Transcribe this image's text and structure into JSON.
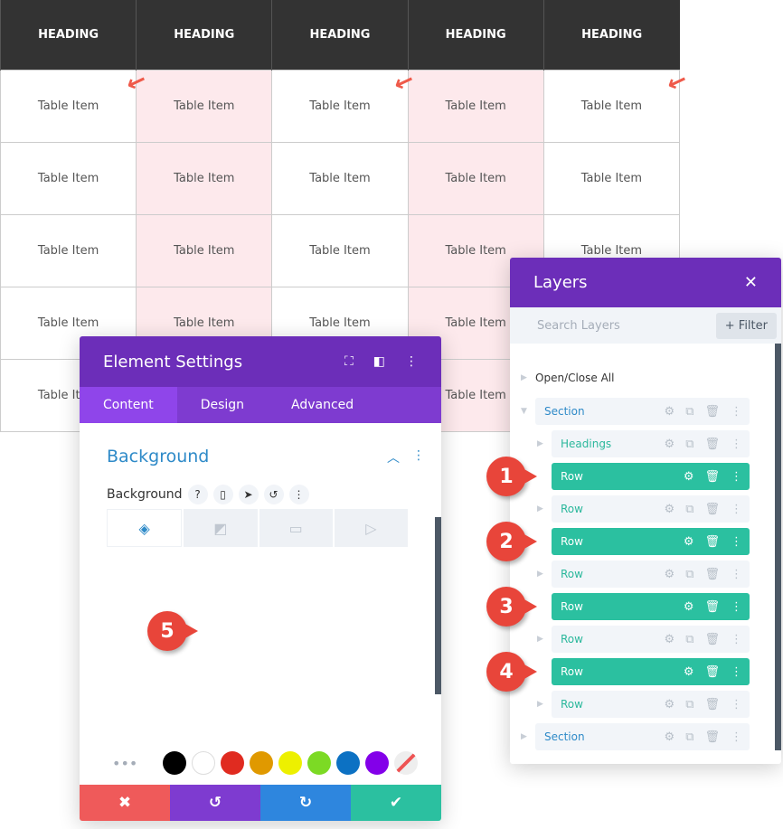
{
  "table": {
    "headers": [
      "HEADING",
      "HEADING",
      "HEADING",
      "HEADING",
      "HEADING"
    ],
    "cell": "Table Item",
    "rows": 5,
    "highlight_color": "#fde9ec"
  },
  "layers": {
    "title": "Layers",
    "search_placeholder": "Search Layers",
    "filter": "+ Filter",
    "open_close": "Open/Close All",
    "items": [
      {
        "label": "Section",
        "type": "sec"
      },
      {
        "label": "Headings",
        "type": "sub"
      },
      {
        "label": "Row",
        "type": "row",
        "badge": "1"
      },
      {
        "label": "Row",
        "type": "sub"
      },
      {
        "label": "Row",
        "type": "row",
        "badge": "2"
      },
      {
        "label": "Row",
        "type": "sub"
      },
      {
        "label": "Row",
        "type": "row",
        "badge": "3"
      },
      {
        "label": "Row",
        "type": "sub"
      },
      {
        "label": "Row",
        "type": "row",
        "badge": "4"
      },
      {
        "label": "Row",
        "type": "sub"
      },
      {
        "label": "Section",
        "type": "sec"
      }
    ]
  },
  "settings": {
    "title": "Element Settings",
    "tabs": [
      "Content",
      "Design",
      "Advanced"
    ],
    "section": "Background",
    "field": "Background",
    "badge": "5",
    "swatches": [
      "#000000",
      "#ffffff",
      "#e02b20",
      "#e09900",
      "#edf000",
      "#7cda24",
      "#0c71c3",
      "#8300e9"
    ]
  },
  "colors": {
    "purple": "#6c2eb9",
    "teal": "#2bc0a0",
    "cancel": "#ef5a5a",
    "undo": "#7e3bd0",
    "redo": "#2e86de",
    "save": "#2bc0a0"
  }
}
